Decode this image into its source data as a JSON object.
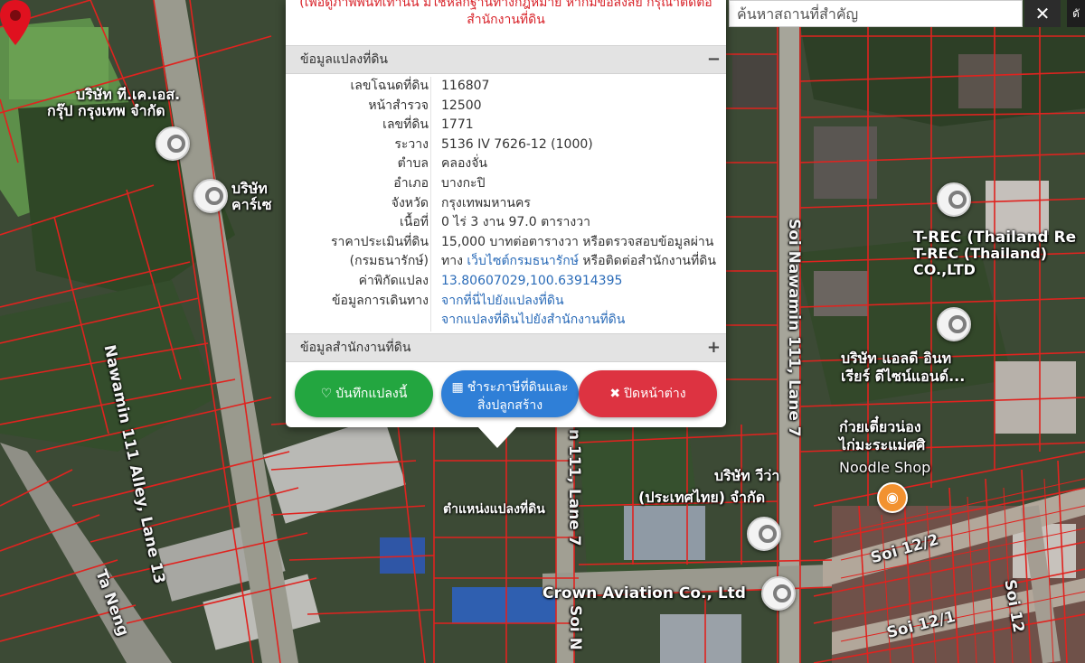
{
  "map": {
    "roads": [
      "Nawamin 111 Alley, Lane 13",
      "Soi Nawamin 111, Lane 7",
      "n 111, Lane 7",
      "Soi 12/2",
      "Soi 12/1",
      "Soi 12",
      "Ta Neng",
      "Soi N"
    ],
    "pois": [
      "บริษัท ที.เค.เอส.",
      "กรุ๊ป กรุงเทพ จำกัด",
      "บริษัท",
      "คาร์เซ",
      "T-REC (Thailand Re",
      "T-REC (Thailand)",
      "CO.,LTD",
      "บริษัท แอลดี อินท",
      "เรียร์ ดีไซน์แอนด์...",
      "ก๋วยเตี๋ยวน่อง",
      "ไก่มะระแม่ศศิ",
      "Noodle Shop",
      "บริษัท วีว่า",
      "(ประเทศไทย) จำกัด",
      "Crown Aviation Co., Ltd"
    ],
    "parcel_marker_label": "ตำแหน่งแปลงที่ดิน"
  },
  "search": {
    "placeholder": "ค้นหาสถานที่สำคัญ",
    "clear_label": "✕",
    "corner_label": "ดั"
  },
  "popup": {
    "notice_line1": "(เพื่อดูภาพพื้นที่เท่านั้น มิใช่หลักฐานทางกฎหมาย หากมีข้อสงสัย กรุณาติดต่อ",
    "notice_line2": "สำนักงานที่ดิน",
    "section1_title": "ข้อมูลแปลงที่ดิน",
    "section1_toggle": "−",
    "section2_title": "ข้อมูลสำนักงานที่ดิน",
    "section2_toggle": "+",
    "rows": [
      {
        "key": "เลขโฉนดที่ดิน",
        "value": "116807"
      },
      {
        "key": "หน้าสำรวจ",
        "value": "12500"
      },
      {
        "key": "เลขที่ดิน",
        "value": "1771"
      },
      {
        "key": "ระวาง",
        "value": "5136 IV 7626-12 (1000)"
      },
      {
        "key": "ตำบล",
        "value": "คลองจั่น"
      },
      {
        "key": "อำเภอ",
        "value": "บางกะปิ"
      },
      {
        "key": "จังหวัด",
        "value": "กรุงเทพมหานคร"
      },
      {
        "key": "เนื้อที่",
        "value": "0 ไร่ 3 งาน 97.0 ตารางวา"
      },
      {
        "key": "ราคาประเมินที่ดิน",
        "value": "15,000 บาทต่อตารางวา หรือตรวจสอบข้อมูลผ่าน"
      },
      {
        "key": "(กรมธนารักษ์)",
        "value_pre": "ทาง ",
        "value_link": "เว็บไซต์กรมธนารักษ์",
        "value_post": " หรือติดต่อสำนักงานที่ดิน"
      },
      {
        "key": "ค่าพิกัดแปลง",
        "value_link": "13.80607029,100.63914395"
      },
      {
        "key": "ข้อมูลการเดินทาง",
        "value_link": "จากที่นี่ไปยังแปลงที่ดิน"
      },
      {
        "key": "",
        "value_link": "จากแปลงที่ดินไปยังสำนักงานที่ดิน"
      }
    ],
    "buttons": {
      "save_icon": "♡",
      "save_label": "บันทึกแปลงนี้",
      "tax_icon": "▦",
      "tax_label_1": "ชำระภาษีที่ดินและ",
      "tax_label_2": "สิ่งปลูกสร้าง",
      "close_icon": "✖",
      "close_label": "ปิดหน้าต่าง"
    }
  },
  "colors": {
    "parcel_lines": "#e0231f",
    "save": "#23a640",
    "tax": "#2f7fd7",
    "close": "#dd3341",
    "link": "#2a6bb8",
    "notice": "#d8232a"
  }
}
